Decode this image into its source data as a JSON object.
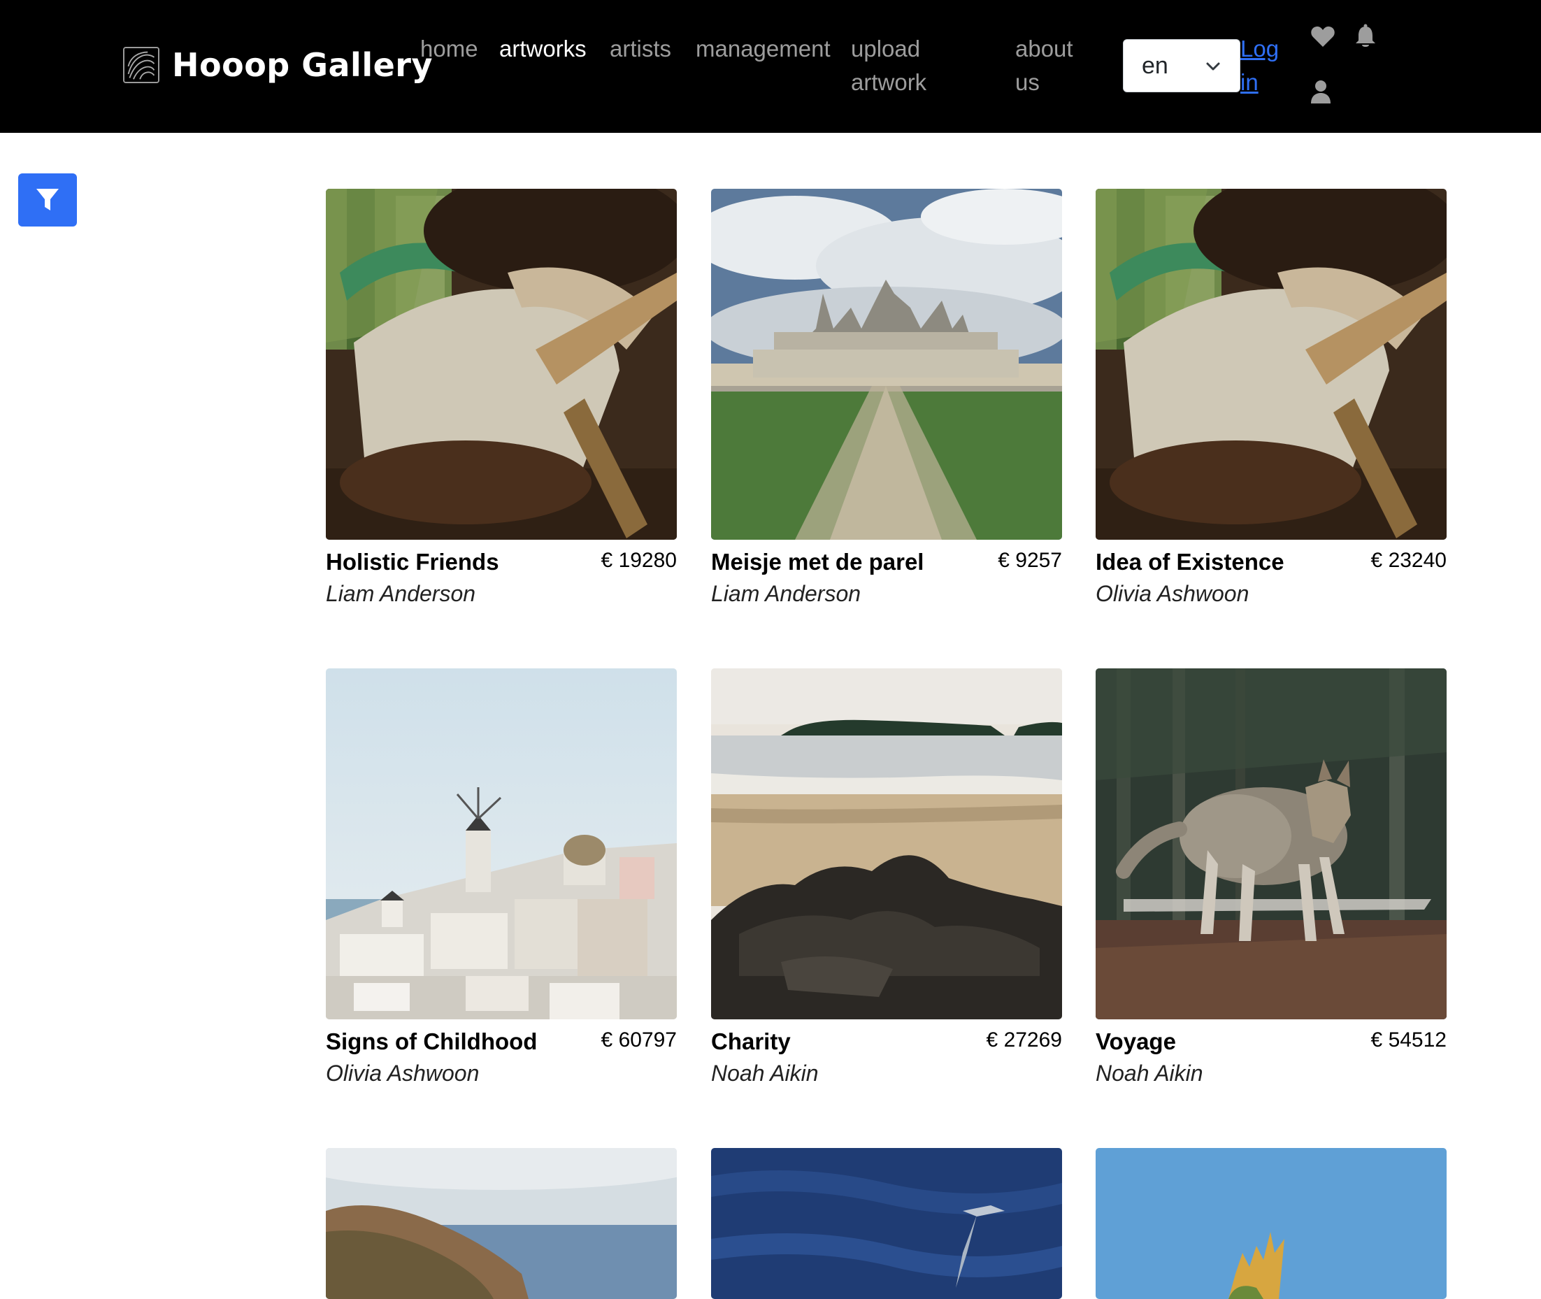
{
  "brand": {
    "name": "Hooop Gallery"
  },
  "nav": {
    "home": "home",
    "artworks": "artworks",
    "artists": "artists",
    "management": "management",
    "upload_artwork": "upload artwork",
    "about_us": "about us",
    "active": "artworks"
  },
  "language": {
    "selected": "en"
  },
  "auth": {
    "login_label": "Log in"
  },
  "icons": {
    "heart": "heart-icon",
    "bell": "bell-icon",
    "user": "user-icon",
    "filter": "filter-icon",
    "chevron": "chevron-down-icon"
  },
  "colors": {
    "header_bg": "#000000",
    "nav_inactive": "#9d9d9d",
    "nav_active": "#ffffff",
    "accent": "#2f6ff5"
  },
  "artworks": [
    {
      "title": "Holistic Friends",
      "price": "€ 19280",
      "artist": "Liam Anderson"
    },
    {
      "title": "Meisje met de parel",
      "price": "€ 9257",
      "artist": "Liam Anderson"
    },
    {
      "title": "Idea of Existence",
      "price": "€ 23240",
      "artist": "Olivia Ashwoon"
    },
    {
      "title": "Signs of Childhood",
      "price": "€ 60797",
      "artist": "Olivia Ashwoon"
    },
    {
      "title": "Charity",
      "price": "€ 27269",
      "artist": "Noah Aikin"
    },
    {
      "title": "Voyage",
      "price": "€ 54512",
      "artist": "Noah Aikin"
    }
  ]
}
